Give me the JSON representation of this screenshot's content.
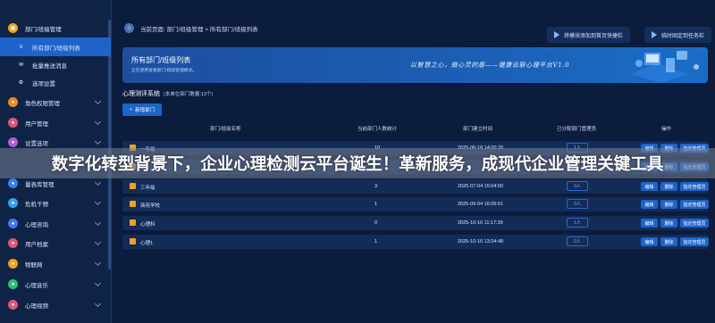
{
  "sidebar": {
    "group_title": "部门/班级管理",
    "items": [
      {
        "label": "所有部门/班级列表",
        "icon": "list-icon",
        "active": true
      },
      {
        "label": "批量推送消息",
        "icon": "message-icon"
      },
      {
        "label": "选项设置",
        "icon": "settings-icon"
      }
    ],
    "menus": [
      {
        "label": "角色权限管理",
        "icon": "role-icon",
        "color": "#f08a24"
      },
      {
        "label": "用户管理",
        "icon": "user-icon",
        "color": "#e2557a"
      },
      {
        "label": "设置选项",
        "icon": "gear-icon",
        "color": "#b05cdb"
      },
      {
        "label": "量表库管理",
        "icon": "scale-library-icon",
        "color": "#3d7bf0"
      },
      {
        "label": "危机干预",
        "icon": "crisis-icon",
        "color": "#3aa3e8"
      },
      {
        "label": "心理咨询",
        "icon": "consult-icon",
        "color": "#3d7bf0"
      },
      {
        "label": "用户档案",
        "icon": "profile-icon",
        "color": "#e2557a"
      },
      {
        "label": "物联网",
        "icon": "iot-icon",
        "color": "#f0a21e"
      },
      {
        "label": "心理音乐",
        "icon": "music-icon",
        "color": "#2fbf71"
      },
      {
        "label": "心理视频",
        "icon": "video-icon",
        "color": "#e2557a"
      }
    ],
    "group_icon_color": "#f0a21e",
    "active_color": "#1e63c9"
  },
  "topbar": {
    "breadcrumb": "当前页面: 部门/班级管理 > 所有部门/班级列表",
    "btn_shortcut": "将模块添加到首页快捷栏",
    "btn_pin": "临时固定到任务栏"
  },
  "banner": {
    "title": "所有部门/班级列表",
    "subtitle": "正在使用查看部门/班级管理模式。",
    "slogan": "以智慧之心，做心灵的盾——健康云联心理平台V1.0"
  },
  "panel": {
    "title": "心理测评系统",
    "count_note": "(本单位部门数量:13个)",
    "add_button": "新增部门",
    "columns": [
      "部门/班级名称",
      "当前部门人数统计",
      "部门建立时间",
      "已分配部门管理员",
      "操作"
    ],
    "rows": [
      {
        "name": "一年级",
        "count": "10",
        "time": "2025-06-18 14:00:20",
        "managers": "1人"
      },
      {
        "name": "",
        "count": "",
        "time": "",
        "managers": ""
      },
      {
        "name": "三年级",
        "count": "3",
        "time": "2025-07-04 15:04:50",
        "managers": "0人"
      },
      {
        "name": "商苑学校",
        "count": "1",
        "time": "2025-09-04 16:05:51",
        "managers": "0人"
      },
      {
        "name": "心理科",
        "count": "0",
        "time": "2025-10-10 11:17:39",
        "managers": "1人"
      },
      {
        "name": "心理1",
        "count": "1",
        "time": "2025-10-10 13:24:48",
        "managers": "0人"
      }
    ],
    "actions": {
      "edit": "编辑",
      "delete": "删除",
      "assign": "指定管理员"
    }
  },
  "overlay": {
    "caption": "数字化转型背景下，企业心理检测云平台诞生！革新服务，成现代企业管理关键工具"
  }
}
